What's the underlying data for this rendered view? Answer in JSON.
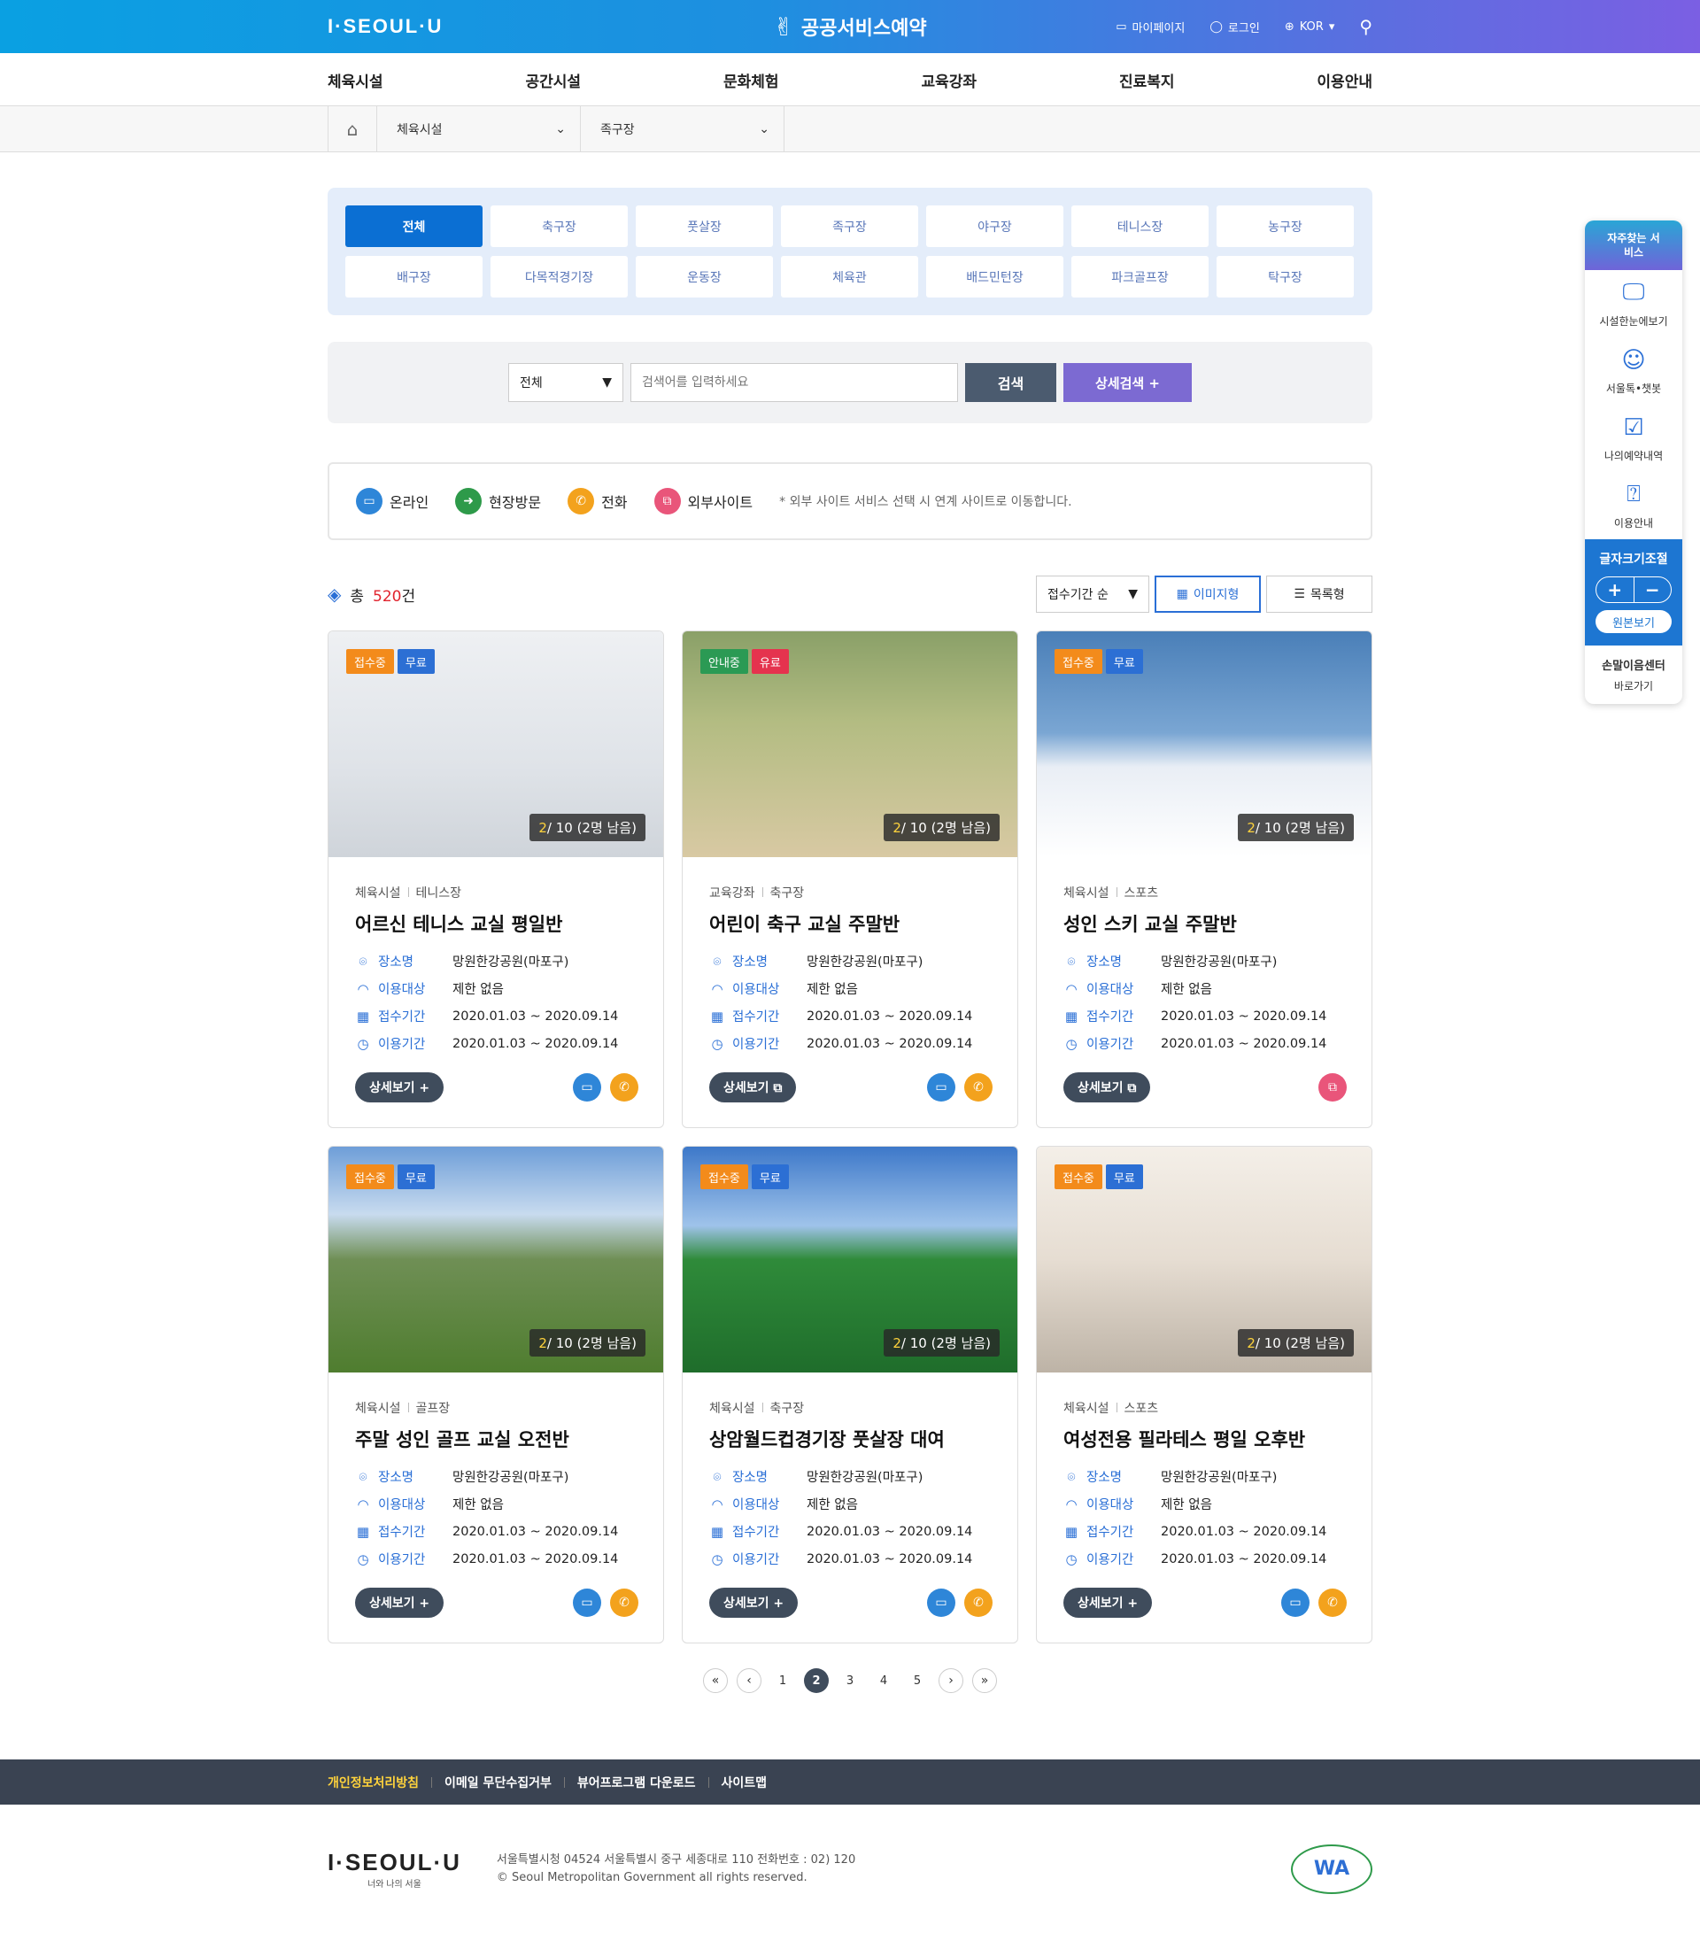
{
  "header": {
    "logo": "I·SEOUL·U",
    "brand": "공공서비스예약",
    "mypage": "마이페이지",
    "login": "로그인",
    "lang": "KOR"
  },
  "gnb": [
    "체육시설",
    "공간시설",
    "문화체험",
    "교육강좌",
    "진료복지",
    "이용안내"
  ],
  "breadcrumb": {
    "first": "체육시설",
    "second": "족구장"
  },
  "categories": {
    "row1": [
      "전체",
      "축구장",
      "풋살장",
      "족구장",
      "야구장",
      "테니스장",
      "농구장"
    ],
    "row2": [
      "배구장",
      "다목적경기장",
      "운동장",
      "체육관",
      "배드민턴장",
      "파크골프장",
      "탁구장"
    ]
  },
  "search": {
    "select": "전체",
    "placeholder": "검색어를 입력하세요",
    "button": "검색",
    "detail": "상세검색 +"
  },
  "legend": {
    "online": "온라인",
    "visit": "현장방문",
    "phone": "전화",
    "external": "외부사이트",
    "note": "* 외부 사이트 서비스 선택 시 연계 사이트로 이동합니다."
  },
  "list": {
    "total_prefix": "총",
    "total_count": "520",
    "total_suffix": "건",
    "sort": "접수기간 순",
    "view_image": "이미지형",
    "view_list": "목록형"
  },
  "labels": {
    "place": "장소명",
    "target": "이용대상",
    "apply": "접수기간",
    "use": "이용기간"
  },
  "cards": [
    {
      "b1": "접수중",
      "b2": "무료",
      "count_a": "2",
      "count_b": "/ 10 (2명 남음)",
      "kind": "체육시설",
      "sub": "테니스장",
      "title": "어르신 테니스 교실 평일반",
      "place": "망원한강공원(마포구)",
      "target": "제한 없음",
      "apply": "2020.01.03 ~ 2020.09.14",
      "use": "2020.01.03 ~ 2020.09.14",
      "more": "상세보기 +"
    },
    {
      "b1": "안내중",
      "b2": "유료",
      "count_a": "2",
      "count_b": "/ 10 (2명 남음)",
      "kind": "교육강좌",
      "sub": "축구장",
      "title": "어린이 축구 교실 주말반",
      "place": "망원한강공원(마포구)",
      "target": "제한 없음",
      "apply": "2020.01.03 ~ 2020.09.14",
      "use": "2020.01.03 ~ 2020.09.14",
      "more": "상세보기 ⧉"
    },
    {
      "b1": "접수중",
      "b2": "무료",
      "count_a": "2",
      "count_b": "/ 10 (2명 남음)",
      "kind": "체육시설",
      "sub": "스포츠",
      "title": "성인 스키 교실 주말반",
      "place": "망원한강공원(마포구)",
      "target": "제한 없음",
      "apply": "2020.01.03 ~ 2020.09.14",
      "use": "2020.01.03 ~ 2020.09.14",
      "more": "상세보기 ⧉"
    },
    {
      "b1": "접수중",
      "b2": "무료",
      "count_a": "2",
      "count_b": "/ 10 (2명 남음)",
      "kind": "체육시설",
      "sub": "골프장",
      "title": "주말 성인 골프 교실 오전반",
      "place": "망원한강공원(마포구)",
      "target": "제한 없음",
      "apply": "2020.01.03 ~ 2020.09.14",
      "use": "2020.01.03 ~ 2020.09.14",
      "more": "상세보기 +"
    },
    {
      "b1": "접수중",
      "b2": "무료",
      "count_a": "2",
      "count_b": "/ 10 (2명 남음)",
      "kind": "체육시설",
      "sub": "축구장",
      "title": "상암월드컵경기장 풋살장 대여",
      "place": "망원한강공원(마포구)",
      "target": "제한 없음",
      "apply": "2020.01.03 ~ 2020.09.14",
      "use": "2020.01.03 ~ 2020.09.14",
      "more": "상세보기 +"
    },
    {
      "b1": "접수중",
      "b2": "무료",
      "count_a": "2",
      "count_b": "/ 10 (2명 남음)",
      "kind": "체육시설",
      "sub": "스포츠",
      "title": "여성전용 필라테스 평일 오후반",
      "place": "망원한강공원(마포구)",
      "target": "제한 없음",
      "apply": "2020.01.03 ~ 2020.09.14",
      "use": "2020.01.03 ~ 2020.09.14",
      "more": "상세보기 +"
    }
  ],
  "pager": [
    "1",
    "2",
    "3",
    "4",
    "5"
  ],
  "quick": {
    "head": "자주찾는 서비스",
    "item1": "시설한눈에보기",
    "item2": "서울톡•챗봇",
    "item3": "나의예약내역",
    "item4": "이용안내",
    "fontsize": "글자크기조절",
    "orig": "원본보기",
    "sign_logo": "손말이음센터",
    "sign": "바로가기"
  },
  "footer": {
    "nav": [
      "개인정보처리방침",
      "이메일 무단수집거부",
      "뷰어프로그램 다운로드",
      "사이트맵"
    ],
    "logo": "I·SEOUL·U",
    "logo_sub": "너와 나의 서울",
    "addr1": "서울특별시청 04524 서울특별시 중구 세종대로 110 전화번호 : 02) 120",
    "addr2": "© Seoul Metropolitan Government all rights reserved.",
    "wa": "WA"
  }
}
